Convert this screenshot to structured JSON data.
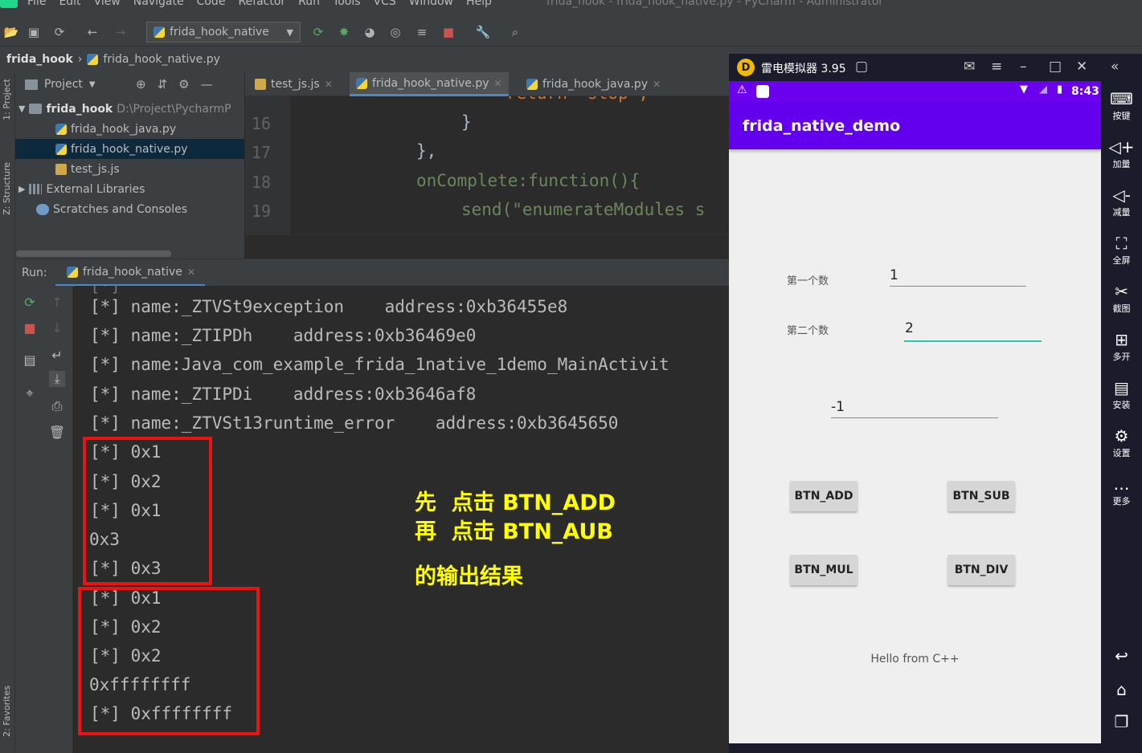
{
  "menu": {
    "items": [
      "File",
      "Edit",
      "View",
      "Navigate",
      "Code",
      "Refactor",
      "Run",
      "Tools",
      "VCS",
      "Window",
      "Help"
    ],
    "window_title": "frida_hook - frida_hook_native.py - PyCharm - Administrator"
  },
  "toolbar": {
    "run_config": "frida_hook_native"
  },
  "breadcrumb": {
    "project": "frida_hook",
    "file": "frida_hook_native.py"
  },
  "left_strip": {
    "project": "1: Project",
    "structure": "Z: Structure",
    "favorites": "2: Favorites"
  },
  "project_panel": {
    "title": "Project",
    "root_name": "frida_hook",
    "root_path": "D:\\Project\\PycharmP",
    "files": [
      "frida_hook_java.py",
      "frida_hook_native.py",
      "test_js.js"
    ],
    "external": "External Libraries",
    "scratches": "Scratches and Consoles"
  },
  "editor": {
    "tabs": [
      "test_js.js",
      "frida_hook_native.py",
      "frida_hook_java.py"
    ],
    "active_tab": 1,
    "line_numbers": [
      "16",
      "17",
      "18",
      "19"
    ],
    "lines": [
      "return 'stop';",
      "}",
      "},",
      "onComplete:function(){",
      "send(\"enumerateModules s"
    ]
  },
  "run_panel": {
    "label": "Run:",
    "tab": "frida_hook_native",
    "console_lines": [
      "[*] name:_ZTVSt9exception    address:0xb36455e8",
      "[*] name:_ZTIPDh    address:0xb36469e0",
      "[*] name:Java_com_example_frida_1native_1demo_MainActivit",
      "[*] name:_ZTIPDi    address:0xb3646af8",
      "[*] name:_ZTVSt13runtime_error    address:0xb3645650",
      "[*] 0x1",
      "[*] 0x2",
      "[*] 0x1",
      "0x3",
      "[*] 0x3",
      "[*] 0x1",
      "[*] 0x2",
      "[*] 0x2",
      "0xffffffff",
      "[*] 0xffffffff"
    ],
    "note": [
      "先  点击 BTN_ADD",
      "再  点击 BTN_AUB",
      "的输出结果"
    ]
  },
  "emulator": {
    "title": "雷电模拟器 3.95",
    "time": "8:43",
    "app_title": "frida_native_demo",
    "label_first": "第一个数",
    "value_first": "1",
    "label_second": "第二个数",
    "value_second": "2",
    "result": "-1",
    "buttons": [
      "BTN_ADD",
      "BTN_SUB",
      "BTN_MUL",
      "BTN_DIV"
    ],
    "hello": "Hello from C++",
    "side": [
      "按键",
      "加量",
      "减量",
      "全屏",
      "截图",
      "多开",
      "安装",
      "设置",
      "更多"
    ]
  }
}
